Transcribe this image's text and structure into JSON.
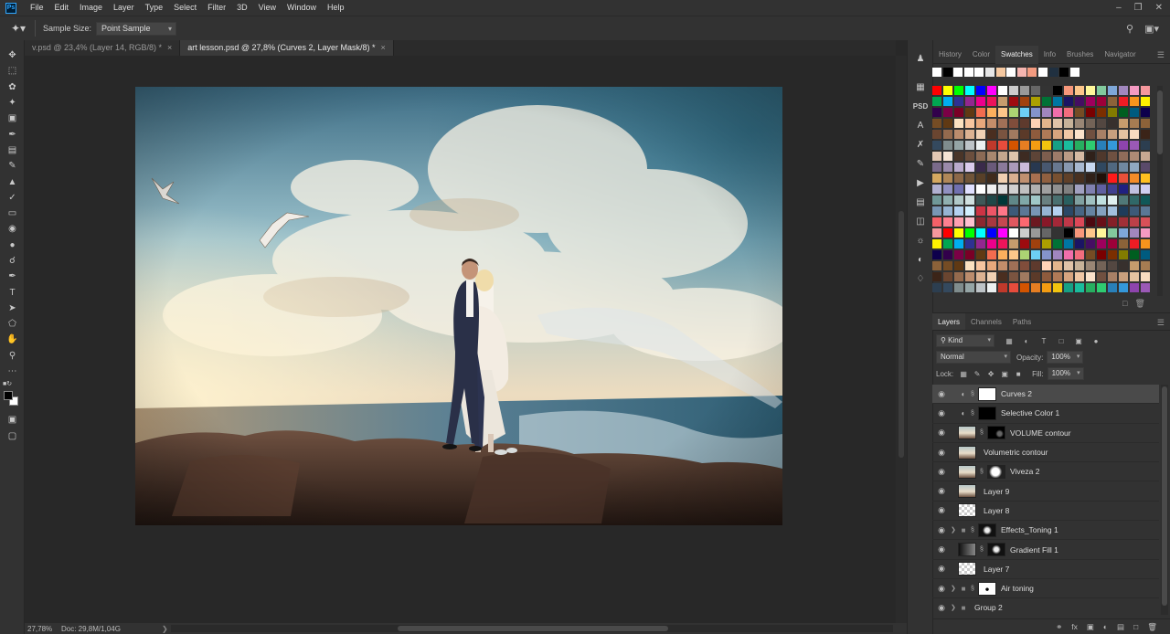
{
  "menubar": {
    "logo": "Ps",
    "items": [
      "File",
      "Edit",
      "Image",
      "Layer",
      "Type",
      "Select",
      "Filter",
      "3D",
      "View",
      "Window",
      "Help"
    ]
  },
  "options_bar": {
    "sample_size_label": "Sample Size:",
    "sample_size_value": "Point Sample"
  },
  "doc_tabs": [
    {
      "label": "v.psd @ 23,4% (Layer 14, RGB/8) *",
      "active": false
    },
    {
      "label": "art lesson.psd @ 27,8% (Curves 2, Layer Mask/8) *",
      "active": true
    }
  ],
  "status": {
    "zoom": "27,78%",
    "doc": "Doc: 29,8M/1,04G"
  },
  "top_panel": {
    "tabs": [
      "History",
      "Color",
      "Swatches",
      "Info",
      "Brushes",
      "Navigator"
    ],
    "active_tab": "Swatches"
  },
  "swatches": {
    "recent": [
      "#ffffff",
      "#000000",
      "#ffffff",
      "#ffffff",
      "#ffffff",
      "#e6e6e6",
      "#f5c8a0",
      "#ffffff",
      "#f5b5b0",
      "#f39b80",
      "#ffffff",
      "#203040",
      "#000000",
      "#ffffff"
    ],
    "palette": [
      [
        "#ff0000",
        "#ffff00",
        "#00ff00",
        "#00ffff",
        "#0000ff",
        "#ff00ff",
        "#ffffff",
        "#cccccc",
        "#999999",
        "#666666",
        "#333333",
        "#000000",
        "#f7977a",
        "#fdc68a",
        "#fff79a",
        "#82ca9d",
        "#7ea7d8",
        "#a187be",
        "#f49ac2",
        "#f6989d"
      ],
      [
        "#ed1c24",
        "#f7941d",
        "#fff200",
        "#00a651",
        "#00aeef",
        "#2e3192",
        "#92278f",
        "#ec008c",
        "#ed145b",
        "#c69c6d",
        "#9e0b0f",
        "#a0410d",
        "#aba000",
        "#007236",
        "#0076a3",
        "#1b1464",
        "#440e62",
        "#9e005d",
        "#9e0039",
        "#8c6239"
      ],
      [
        "#790000",
        "#7b2e00",
        "#827b00",
        "#005e20",
        "#005b7f",
        "#0d004c",
        "#32004b",
        "#7b0046",
        "#7a0026",
        "#603913",
        "#f26c4f",
        "#fbaf5d",
        "#fdc689",
        "#acd373",
        "#6dcff6",
        "#8493ca",
        "#a186be",
        "#f06eaa",
        "#f26d7d",
        "#754c24"
      ],
      [
        "#e0c3a8",
        "#c7b299",
        "#998675",
        "#736357",
        "#534741",
        "#37302d",
        "#c69c6d",
        "#a67c52",
        "#8c6239",
        "#754c24",
        "#603913",
        "#fbe1c0",
        "#f7c59f",
        "#e8a87c",
        "#c38d6a",
        "#a07057",
        "#804d3b",
        "#5e3a2d",
        "#ffd3b6",
        "#e3b58c"
      ],
      [
        "#5b3a29",
        "#8e5b3d",
        "#b07a57",
        "#d8a47f",
        "#f1c7a5",
        "#fbe2cb",
        "#705040",
        "#a78066",
        "#c8a07e",
        "#e5c3a1",
        "#f8dcc0",
        "#3b2418",
        "#6a4530",
        "#946a4e",
        "#bb8c6d",
        "#dcb292",
        "#f0d1b5",
        "#4a2e20",
        "#7a5440",
        "#a07a60"
      ],
      [
        "#c0392b",
        "#e74c3c",
        "#d35400",
        "#e67e22",
        "#f39c12",
        "#f1c40f",
        "#16a085",
        "#1abc9c",
        "#27ae60",
        "#2ecc71",
        "#2980b9",
        "#3498db",
        "#8e44ad",
        "#9b59b6",
        "#2c3e50",
        "#34495e",
        "#7f8c8d",
        "#95a5a6",
        "#bdc3c7",
        "#ecf0f1"
      ],
      [
        "#4a3528",
        "#6b4e3d",
        "#8b6a55",
        "#a8876f",
        "#c4a68d",
        "#ddc5ad",
        "#3d2b22",
        "#5d4437",
        "#7d5e4e",
        "#9d7b69",
        "#bb9a85",
        "#d6b9a3",
        "#2f211a",
        "#4f382c",
        "#6f5141",
        "#8f6c5a",
        "#ad8a75",
        "#c9a892",
        "#e2c7b2",
        "#f5e3d3"
      ],
      [
        "#5a4a6a",
        "#7a6a8a",
        "#9a8aaa",
        "#baaacc",
        "#dacbec",
        "#3a2a4a",
        "#6a5a7a",
        "#8a7a9a",
        "#aa9aba",
        "#cabada",
        "#283850",
        "#485870",
        "#687890",
        "#8898b0",
        "#a8b8d0",
        "#c8d8f0",
        "#304860",
        "#506880",
        "#7088a0",
        "#90a8c0"
      ],
      [
        "#ff1a1a",
        "#e8503a",
        "#f58c28",
        "#ffc020",
        "#d4a860",
        "#b08858",
        "#8c6848",
        "#705438",
        "#584028",
        "#402c1c",
        "#f0d0b0",
        "#d8b090",
        "#c09070",
        "#a87050",
        "#906040",
        "#785030",
        "#604028",
        "#483020",
        "#302018",
        "#201008"
      ],
      [
        "#a0a0c0",
        "#8080b0",
        "#6060a0",
        "#404090",
        "#202080",
        "#c0c0e0",
        "#d0d0f0",
        "#b0b0d0",
        "#9090c0",
        "#7070b0",
        "#e0e0ff",
        "#ffffff",
        "#f0f0f0",
        "#e0e0e0",
        "#d0d0d0",
        "#c0c0c0",
        "#b0b0b0",
        "#a0a0a0",
        "#909090",
        "#808080"
      ],
      [
        "#6a8080",
        "#4a7070",
        "#2a6060",
        "#80a0a0",
        "#a0c0c0",
        "#c0e0e0",
        "#e0f0f0",
        "#507878",
        "#306868",
        "#105858",
        "#709898",
        "#90b0b0",
        "#b0c8c8",
        "#d0e0e0",
        "#405858",
        "#204848",
        "#003838",
        "#608888",
        "#80a8a8",
        "#a0c8c8"
      ],
      [
        "#3c5a78",
        "#5a7896",
        "#7896b4",
        "#96b4d2",
        "#b4d2f0",
        "#2a4866",
        "#486684",
        "#6684a2",
        "#84a2c0",
        "#a2c0de",
        "#1e3c5a",
        "#3c5a78",
        "#5a7896",
        "#7896b4",
        "#96b4d2",
        "#b4d2f0",
        "#d2f0ff",
        "#cc3344",
        "#ee5566",
        "#ff7788"
      ],
      [
        "#8c2830",
        "#a83840",
        "#c44850",
        "#e05860",
        "#fc6870",
        "#6c1820",
        "#881828",
        "#a42838",
        "#c03848",
        "#dc4858",
        "#4c0810",
        "#681018",
        "#842028",
        "#a03038",
        "#bc4048",
        "#d85058",
        "#f46068",
        "#ff8090",
        "#ffa0b0",
        "#ffc0d0"
      ]
    ]
  },
  "layers_panel": {
    "tabs": [
      "Layers",
      "Channels",
      "Paths"
    ],
    "active_tab": "Layers",
    "filter_kind": "Kind",
    "blend_mode": "Normal",
    "opacity_label": "Opacity:",
    "opacity_value": "100%",
    "lock_label": "Lock:",
    "fill_label": "Fill:",
    "fill_value": "100%",
    "layers": [
      {
        "name": "Curves 2",
        "kind": "adjust",
        "mask": "white",
        "selected": true
      },
      {
        "name": "Selective Color 1",
        "kind": "adjust",
        "mask": "black",
        "selected": false
      },
      {
        "name": "VOLUME contour",
        "kind": "photo",
        "mask": "black-spots",
        "selected": false
      },
      {
        "name": "Volumetric contour",
        "kind": "photo",
        "mask": "none",
        "selected": false
      },
      {
        "name": "Viveza 2",
        "kind": "photo",
        "mask": "cloud",
        "selected": false
      },
      {
        "name": "Layer 9",
        "kind": "photo",
        "mask": "none",
        "selected": false
      },
      {
        "name": "Layer 8",
        "kind": "checker",
        "mask": "none",
        "selected": false
      },
      {
        "name": "Effects_Toning 1",
        "kind": "group",
        "mask": "dark",
        "selected": false
      },
      {
        "name": "Gradient Fill 1",
        "kind": "gradient",
        "mask": "dark",
        "selected": false
      },
      {
        "name": "Layer 7",
        "kind": "checker",
        "mask": "none",
        "selected": false
      },
      {
        "name": "Air toning",
        "kind": "group",
        "mask": "white-dot",
        "selected": false
      },
      {
        "name": "Group 2",
        "kind": "group-nomask",
        "mask": "none",
        "selected": false
      }
    ]
  }
}
